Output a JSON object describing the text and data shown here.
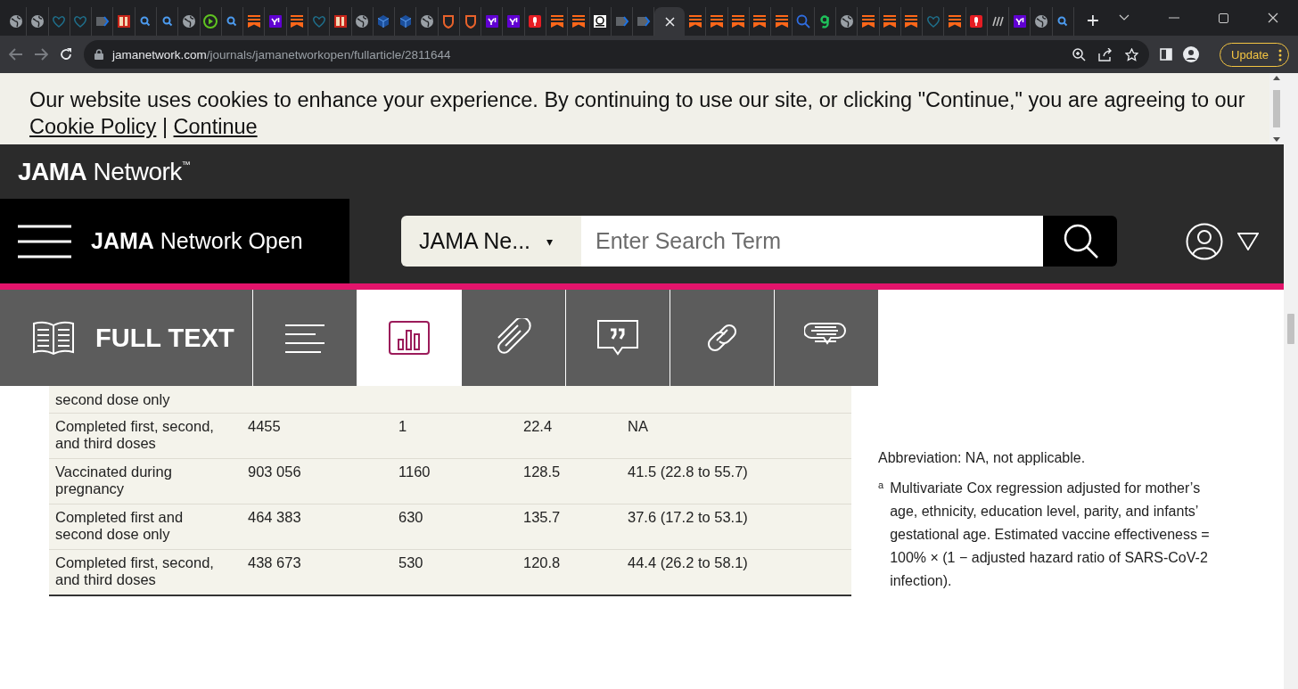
{
  "browser": {
    "tabs": [
      {
        "kind": "globe",
        "selected": false
      },
      {
        "kind": "globe",
        "selected": false
      },
      {
        "kind": "heart",
        "selected": false
      },
      {
        "kind": "heart",
        "selected": false
      },
      {
        "kind": "arrow",
        "selected": false
      },
      {
        "kind": "bi",
        "selected": false
      },
      {
        "kind": "search",
        "selected": false
      },
      {
        "kind": "search",
        "selected": false
      },
      {
        "kind": "globe",
        "selected": false
      },
      {
        "kind": "play",
        "selected": false
      },
      {
        "kind": "search",
        "selected": false
      },
      {
        "kind": "bookmark",
        "selected": false
      },
      {
        "kind": "yahoo",
        "selected": false
      },
      {
        "kind": "bookmark",
        "selected": false
      },
      {
        "kind": "heart",
        "selected": false
      },
      {
        "kind": "bi",
        "selected": false
      },
      {
        "kind": "globe",
        "selected": false
      },
      {
        "kind": "cube",
        "selected": false
      },
      {
        "kind": "cube",
        "selected": false
      },
      {
        "kind": "globe",
        "selected": false
      },
      {
        "kind": "shield",
        "selected": false
      },
      {
        "kind": "shield",
        "selected": false
      },
      {
        "kind": "yahoo",
        "selected": false
      },
      {
        "kind": "yahoo",
        "selected": false
      },
      {
        "kind": "mic",
        "selected": false
      },
      {
        "kind": "bookmark",
        "selected": false
      },
      {
        "kind": "bookmark",
        "selected": false
      },
      {
        "kind": "od",
        "selected": false
      },
      {
        "kind": "arrow",
        "selected": false
      },
      {
        "kind": "arrow",
        "selected": false
      },
      {
        "selected": true
      },
      {
        "kind": "bookmark",
        "selected": false
      },
      {
        "kind": "bookmark",
        "selected": false
      },
      {
        "kind": "bookmark",
        "selected": false
      },
      {
        "kind": "bookmark",
        "selected": false
      },
      {
        "kind": "bookmark",
        "selected": false
      },
      {
        "kind": "bigsearch",
        "selected": false
      },
      {
        "kind": "g",
        "selected": false
      },
      {
        "kind": "globe",
        "selected": false
      },
      {
        "kind": "bookmark",
        "selected": false
      },
      {
        "kind": "bookmark",
        "selected": false
      },
      {
        "kind": "bookmark",
        "selected": false
      },
      {
        "kind": "heart",
        "selected": false
      },
      {
        "kind": "bookmark",
        "selected": false
      },
      {
        "kind": "mic",
        "selected": false
      },
      {
        "kind": "dr",
        "selected": false
      },
      {
        "kind": "yahoo",
        "selected": false
      },
      {
        "kind": "globe",
        "selected": false
      },
      {
        "kind": "search",
        "selected": false
      }
    ],
    "url_domain": "jamanetwork.com",
    "url_path": "/journals/jamanetworkopen/fullarticle/2811644",
    "update_label": "Update"
  },
  "cookie_banner": {
    "text": "Our website uses cookies to enhance your experience. By continuing to use our site, or clicking \"Continue,\" you are agreeing to our",
    "policy_link": "Cookie Policy",
    "separator": "|",
    "continue_link": "Continue"
  },
  "site_header": {
    "brand": "**JAMA** Network$^{™}$"
  },
  "journal_nav": {
    "title": "**JAMA** Network Open",
    "search_scope": "JAMA Ne...",
    "scope_caret": "▾",
    "search_placeholder": "Enter Search Term"
  },
  "article_toolbar": {
    "tabs": [
      {
        "kind": "full-text",
        "label": "FULL TEXT",
        "selected": false
      },
      {
        "kind": "outline",
        "selected": false
      },
      {
        "kind": "figures",
        "selected": true
      },
      {
        "kind": "attachments",
        "selected": false
      },
      {
        "kind": "cite",
        "selected": false
      },
      {
        "kind": "links",
        "selected": false
      },
      {
        "kind": "comments",
        "selected": false
      }
    ]
  },
  "table": {
    "rows": [
      {
        "cells": [
          "second dose only"
        ]
      },
      {
        "cells": [
          "Completed first, second, and third doses",
          "4455",
          "1",
          "22.4",
          "NA"
        ]
      },
      {
        "cells": [
          "Vaccinated during pregnancy",
          "903 056",
          "1160",
          "128.5",
          "41.5 (22.8 to 55.7)"
        ]
      },
      {
        "cells": [
          "Completed first and second dose only",
          "464 383",
          "630",
          "135.7",
          "37.6 (17.2 to 53.1)"
        ]
      },
      {
        "cells": [
          "Completed first, second, and third doses",
          "438 673",
          "530",
          "120.8",
          "44.4 (26.2 to 58.1)"
        ]
      }
    ]
  },
  "notes": {
    "abbreviation": "Abbreviation: NA, not applicable.",
    "marker": "a",
    "footnote": "Multivariate Cox regression adjusted for mother’s age, ethnicity, education level, parity, and infants’ gestational age. Estimated vaccine effectiveness = 100% × (1 − adjusted hazard ratio of SARS-CoV-2 infection)."
  }
}
